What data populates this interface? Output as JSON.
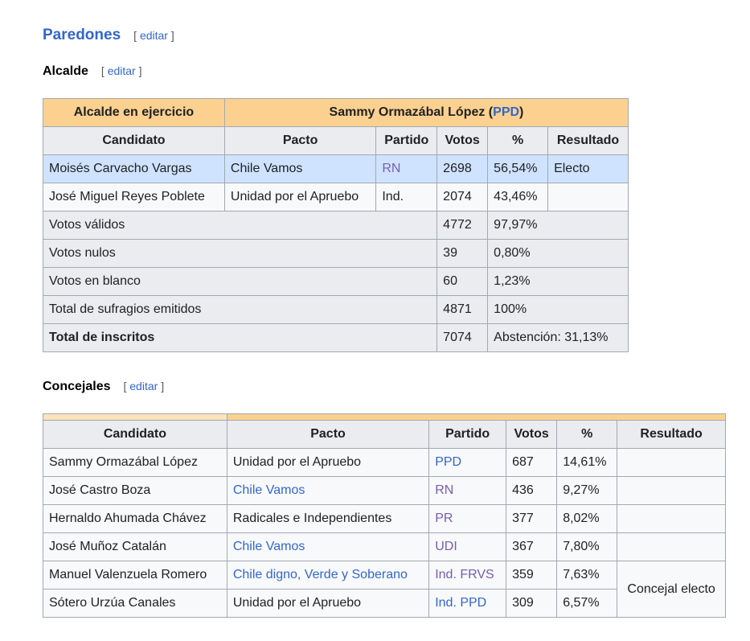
{
  "section": {
    "title": "Paredones",
    "edit_open": "[",
    "edit_label": "editar",
    "edit_close": "]"
  },
  "alcalde": {
    "title": "Alcalde",
    "edit_label": "editar",
    "incumbent_label": "Alcalde en ejercicio",
    "incumbent_name": "Sammy Ormazábal López",
    "incumbent_party": "PPD",
    "headers": [
      "Candidato",
      "Pacto",
      "Partido",
      "Votos",
      "%",
      "Resultado"
    ],
    "rows": [
      {
        "candidato": "Moisés Carvacho Vargas",
        "pacto": "Chile Vamos",
        "partido": "RN",
        "votos": "2698",
        "pct": "56,54%",
        "resultado": "Electo"
      },
      {
        "candidato": "José Miguel Reyes Poblete",
        "pacto": "Unidad por el Apruebo",
        "partido": "Ind.",
        "votos": "2074",
        "pct": "43,46%",
        "resultado": ""
      }
    ],
    "totals": [
      {
        "label": "Votos válidos",
        "votos": "4772",
        "pct": "97,97%"
      },
      {
        "label": "Votos nulos",
        "votos": "39",
        "pct": "0,80%"
      },
      {
        "label": "Votos en blanco",
        "votos": "60",
        "pct": "1,23%"
      },
      {
        "label": "Total de sufragios emitidos",
        "votos": "4871",
        "pct": "100%"
      },
      {
        "label": "Total de inscritos",
        "votos": "7074",
        "pct": "Abstención: 31,13%"
      }
    ]
  },
  "concejales": {
    "title": "Concejales",
    "edit_label": "editar",
    "headers": [
      "Candidato",
      "Pacto",
      "Partido",
      "Votos",
      "%",
      "Resultado"
    ],
    "rows": [
      {
        "candidato": "Sammy Ormazábal López",
        "pacto": "Unidad por el Apruebo",
        "partido": "PPD",
        "votos": "687",
        "pct": "14,61%"
      },
      {
        "candidato": "José Castro Boza",
        "pacto": "Chile Vamos",
        "partido": "RN",
        "votos": "436",
        "pct": "9,27%"
      },
      {
        "candidato": "Hernaldo Ahumada Chávez",
        "pacto": "Radicales e Independientes",
        "partido": "PR",
        "votos": "377",
        "pct": "8,02%"
      },
      {
        "candidato": "José Muñoz Catalán",
        "pacto": "Chile Vamos",
        "partido": "UDI",
        "votos": "367",
        "pct": "7,80%"
      },
      {
        "candidato": "Manuel Valenzuela Romero",
        "pacto": "Chile digno, Verde y Soberano",
        "partido": "Ind. FRVS",
        "votos": "359",
        "pct": "7,63%"
      },
      {
        "candidato": "Sótero Urzúa Canales",
        "pacto": "Unidad por el Apruebo",
        "partido": "Ind. PPD",
        "votos": "309",
        "pct": "6,57%"
      }
    ],
    "resultado_merged": "Concejal electo"
  },
  "colors": {
    "link": "#3366cc",
    "visited_link": "#795cb2",
    "header_orange": "#fcd190",
    "winner_row": "#cfe3ff",
    "header_gray": "#eaecf0"
  }
}
